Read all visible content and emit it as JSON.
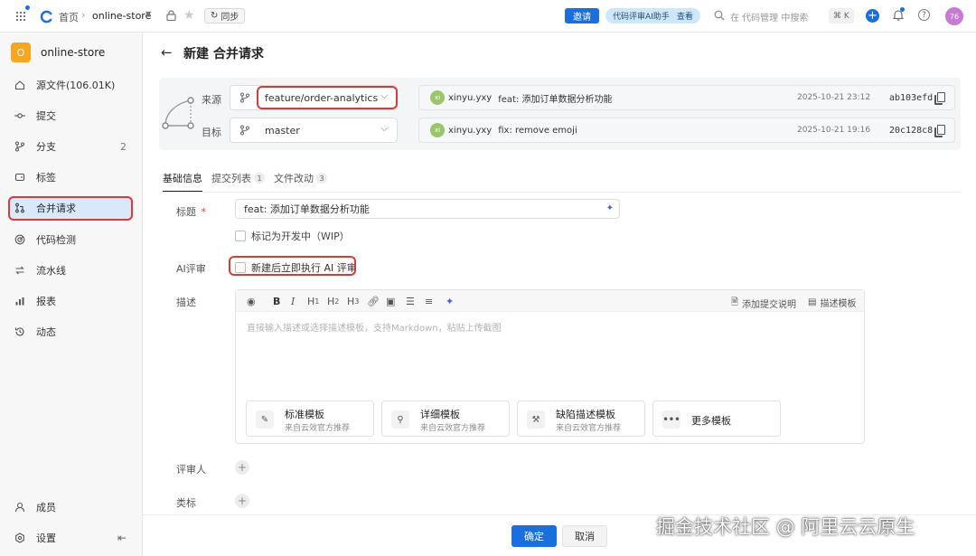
{
  "topbar": {
    "home": "首页",
    "repo": "online-store",
    "sync": "同步",
    "invite": "邀请",
    "ai_helper": "代码评审AI助手",
    "ai_view": "查看",
    "search_placeholder": "在 代码管理 中搜索",
    "shortcut": "⌘ K",
    "avatar": "76"
  },
  "sidebar": {
    "repo_initial": "O",
    "repo_name": "online-store",
    "items": [
      {
        "label": "源文件(106.01K)",
        "count": ""
      },
      {
        "label": "提交",
        "count": ""
      },
      {
        "label": "分支",
        "count": "2"
      },
      {
        "label": "标签",
        "count": ""
      },
      {
        "label": "合并请求",
        "count": ""
      },
      {
        "label": "代码检测",
        "count": ""
      },
      {
        "label": "流水线",
        "count": ""
      },
      {
        "label": "报表",
        "count": ""
      },
      {
        "label": "动态",
        "count": ""
      }
    ],
    "members": "成员",
    "settings": "设置"
  },
  "page": {
    "title": "新建 合并请求",
    "source_label": "来源",
    "target_label": "目标",
    "source_branch": "feature/order-analytics",
    "target_branch": "master",
    "source_commit": {
      "avatar": "xi",
      "author": "xinyu.yxy",
      "message": "feat: 添加订单数据分析功能",
      "date": "2025-10-21 23:12",
      "sha": "ab103efd"
    },
    "target_commit": {
      "avatar": "xi",
      "author": "xinyu.yxy",
      "message": "fix: remove emoji",
      "date": "2025-10-21 19:16",
      "sha": "20c128c8"
    }
  },
  "tabs": [
    {
      "label": "基础信息",
      "count": ""
    },
    {
      "label": "提交列表",
      "count": "1"
    },
    {
      "label": "文件改动",
      "count": "3"
    }
  ],
  "form": {
    "title_label": "标题",
    "required_mark": "*",
    "title_value": "feat: 添加订单数据分析功能",
    "wip_label": "标记为开发中（WIP）",
    "ai_review_label": "AI评审",
    "ai_review_option": "新建后立即执行 AI 评审",
    "desc_label": "描述",
    "add_commit_note": "添加提交说明",
    "desc_template": "描述模板",
    "desc_placeholder": "直接输入描述或选择描述模板，支持Markdown，粘贴上传截图",
    "reviewer_label": "评审人",
    "category_label": "类标"
  },
  "templates": [
    {
      "title": "标准模板",
      "sub": "来自云效官方推荐"
    },
    {
      "title": "详细模板",
      "sub": "来自云效官方推荐"
    },
    {
      "title": "缺陷描述模板",
      "sub": "来自云效官方推荐"
    },
    {
      "title": "更多模板",
      "sub": ""
    }
  ],
  "footer": {
    "confirm": "确定",
    "cancel": "取消"
  },
  "watermark": "掘金技术社区 @ 阿里云云原生",
  "colors": {
    "primary": "#1a6ede",
    "annotation": "#d93a3a",
    "active_bg": "#d9e8fb"
  }
}
